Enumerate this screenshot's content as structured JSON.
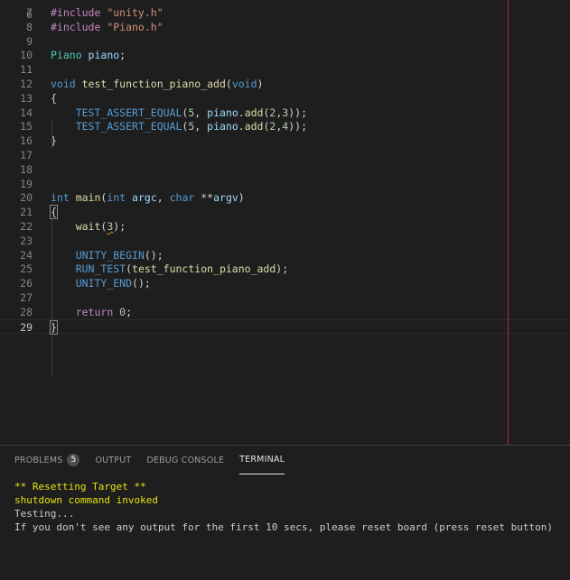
{
  "editor": {
    "lines": [
      {
        "num": "7",
        "tokens": [
          {
            "t": "#include ",
            "c": "#c586c0"
          },
          {
            "t": "\"unity.h\"",
            "c": "#ce9178"
          }
        ]
      },
      {
        "num": "8",
        "tokens": [
          {
            "t": "#include ",
            "c": "#c586c0"
          },
          {
            "t": "\"Piano.h\"",
            "c": "#ce9178"
          }
        ]
      },
      {
        "num": "9",
        "tokens": []
      },
      {
        "num": "10",
        "tokens": [
          {
            "t": "Piano ",
            "c": "#4ec9b0"
          },
          {
            "t": "piano",
            "c": "#9cdcfe"
          },
          {
            "t": ";",
            "c": "#d4d4d4"
          }
        ]
      },
      {
        "num": "11",
        "tokens": []
      },
      {
        "num": "12",
        "tokens": [
          {
            "t": "void ",
            "c": "#569cd6"
          },
          {
            "t": "test_function_piano_add",
            "c": "#dcdcaa"
          },
          {
            "t": "(",
            "c": "#d4d4d4"
          },
          {
            "t": "void",
            "c": "#569cd6"
          },
          {
            "t": ")",
            "c": "#d4d4d4"
          }
        ]
      },
      {
        "num": "13",
        "tokens": [
          {
            "t": "{",
            "c": "#d4d4d4"
          }
        ]
      },
      {
        "num": "14",
        "tokens": [
          {
            "t": "    ",
            "c": "#d4d4d4"
          },
          {
            "t": "TEST_ASSERT_EQUAL",
            "c": "#569cd6"
          },
          {
            "t": "(",
            "c": "#d4d4d4"
          },
          {
            "t": "5",
            "c": "#b5cea8"
          },
          {
            "t": ", ",
            "c": "#d4d4d4"
          },
          {
            "t": "piano",
            "c": "#9cdcfe"
          },
          {
            "t": ".",
            "c": "#d4d4d4"
          },
          {
            "t": "add",
            "c": "#dcdcaa"
          },
          {
            "t": "(",
            "c": "#d4d4d4"
          },
          {
            "t": "2",
            "c": "#b5cea8"
          },
          {
            "t": ",",
            "c": "#d4d4d4"
          },
          {
            "t": "3",
            "c": "#b5cea8"
          },
          {
            "t": "));",
            "c": "#d4d4d4"
          }
        ]
      },
      {
        "num": "15",
        "tokens": [
          {
            "t": "    ",
            "c": "#d4d4d4"
          },
          {
            "t": "TEST_ASSERT_EQUAL",
            "c": "#569cd6"
          },
          {
            "t": "(",
            "c": "#d4d4d4"
          },
          {
            "t": "5",
            "c": "#b5cea8"
          },
          {
            "t": ", ",
            "c": "#d4d4d4"
          },
          {
            "t": "piano",
            "c": "#9cdcfe"
          },
          {
            "t": ".",
            "c": "#d4d4d4"
          },
          {
            "t": "add",
            "c": "#dcdcaa"
          },
          {
            "t": "(",
            "c": "#d4d4d4"
          },
          {
            "t": "2",
            "c": "#b5cea8"
          },
          {
            "t": ",",
            "c": "#d4d4d4"
          },
          {
            "t": "4",
            "c": "#b5cea8"
          },
          {
            "t": "));",
            "c": "#d4d4d4"
          }
        ]
      },
      {
        "num": "16",
        "tokens": [
          {
            "t": "}",
            "c": "#d4d4d4"
          }
        ]
      },
      {
        "num": "17",
        "tokens": []
      },
      {
        "num": "18",
        "tokens": []
      },
      {
        "num": "19",
        "tokens": []
      },
      {
        "num": "20",
        "tokens": [
          {
            "t": "int ",
            "c": "#569cd6"
          },
          {
            "t": "main",
            "c": "#dcdcaa"
          },
          {
            "t": "(",
            "c": "#d4d4d4"
          },
          {
            "t": "int ",
            "c": "#569cd6"
          },
          {
            "t": "argc",
            "c": "#9cdcfe"
          },
          {
            "t": ", ",
            "c": "#d4d4d4"
          },
          {
            "t": "char ",
            "c": "#569cd6"
          },
          {
            "t": "**",
            "c": "#d4d4d4"
          },
          {
            "t": "argv",
            "c": "#9cdcfe"
          },
          {
            "t": ")",
            "c": "#d4d4d4"
          }
        ]
      },
      {
        "num": "21",
        "tokens": [
          {
            "t": "{",
            "c": "#d4d4d4",
            "box": true
          }
        ]
      },
      {
        "num": "22",
        "tokens": [
          {
            "t": "    ",
            "c": "#d4d4d4"
          },
          {
            "t": "wait",
            "c": "#dcdcaa"
          },
          {
            "t": "(",
            "c": "#d4d4d4"
          },
          {
            "t": "3",
            "c": "#b5cea8",
            "squiggle": true
          },
          {
            "t": ");",
            "c": "#d4d4d4"
          }
        ]
      },
      {
        "num": "23",
        "tokens": []
      },
      {
        "num": "24",
        "tokens": [
          {
            "t": "    ",
            "c": "#d4d4d4"
          },
          {
            "t": "UNITY_BEGIN",
            "c": "#569cd6"
          },
          {
            "t": "();",
            "c": "#d4d4d4"
          }
        ]
      },
      {
        "num": "25",
        "tokens": [
          {
            "t": "    ",
            "c": "#d4d4d4"
          },
          {
            "t": "RUN_TEST",
            "c": "#569cd6"
          },
          {
            "t": "(",
            "c": "#d4d4d4"
          },
          {
            "t": "test_function_piano_add",
            "c": "#dcdcaa"
          },
          {
            "t": ");",
            "c": "#d4d4d4"
          }
        ]
      },
      {
        "num": "26",
        "tokens": [
          {
            "t": "    ",
            "c": "#d4d4d4"
          },
          {
            "t": "UNITY_END",
            "c": "#569cd6"
          },
          {
            "t": "();",
            "c": "#d4d4d4"
          }
        ]
      },
      {
        "num": "27",
        "tokens": []
      },
      {
        "num": "28",
        "tokens": [
          {
            "t": "    ",
            "c": "#d4d4d4"
          },
          {
            "t": "return ",
            "c": "#c586c0"
          },
          {
            "t": "0",
            "c": "#b5cea8"
          },
          {
            "t": ";",
            "c": "#d4d4d4"
          }
        ]
      },
      {
        "num": "29",
        "tokens": [
          {
            "t": "}",
            "c": "#d4d4d4",
            "box": true
          }
        ]
      }
    ]
  },
  "panel": {
    "tabs": [
      {
        "label": "PROBLEMS",
        "badge": "5"
      },
      {
        "label": "OUTPUT"
      },
      {
        "label": "DEBUG CONSOLE"
      },
      {
        "label": "TERMINAL",
        "active": true
      }
    ],
    "terminal_lines": [
      {
        "text": "** Resetting Target **",
        "color": "#e5e510"
      },
      {
        "text": "shutdown command invoked",
        "color": "#e5e510"
      },
      {
        "text": "Testing...",
        "color": "#cccccc"
      },
      {
        "text": "If you don't see any output for the first 10 secs, please reset board (press reset button)",
        "color": "#cccccc"
      }
    ]
  }
}
